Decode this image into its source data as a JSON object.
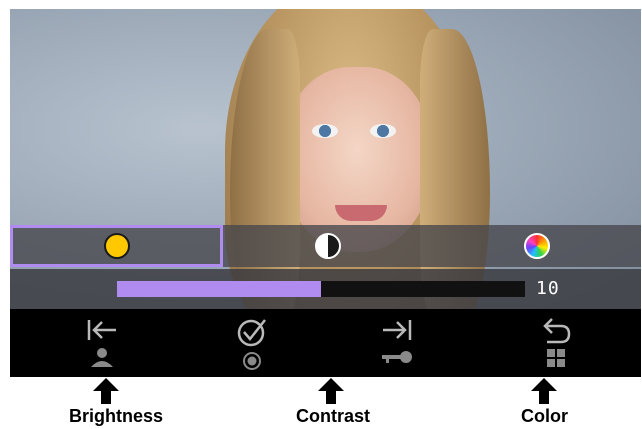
{
  "image": {
    "subject": "portrait-photo"
  },
  "adjust_tabs": [
    {
      "id": "brightness",
      "icon": "brightness-dot-icon",
      "color": "#ffc800",
      "selected": true
    },
    {
      "id": "contrast",
      "icon": "contrast-dot-icon",
      "selected": false
    },
    {
      "id": "color",
      "icon": "color-wheel-icon",
      "selected": false
    }
  ],
  "slider": {
    "value": "10",
    "level_fraction": 0.5,
    "fill_color": "#b18cf0"
  },
  "toolbar": {
    "keys": [
      {
        "top_icon": "back-to-start-icon",
        "bottom_icon": "person-icon"
      },
      {
        "top_icon": "check-circle-icon",
        "bottom_icon": "record-icon"
      },
      {
        "top_icon": "skip-to-end-icon",
        "bottom_icon": "key-icon"
      },
      {
        "top_icon": "undo-return-icon",
        "bottom_icon": "grid-icon"
      }
    ]
  },
  "annotations": {
    "brightness": "Brightness",
    "contrast": "Contrast",
    "color": "Color"
  },
  "colors": {
    "accent": "#b18cf0",
    "toolbar_bg": "#000000",
    "icon_gray": "#b9b9b9"
  }
}
